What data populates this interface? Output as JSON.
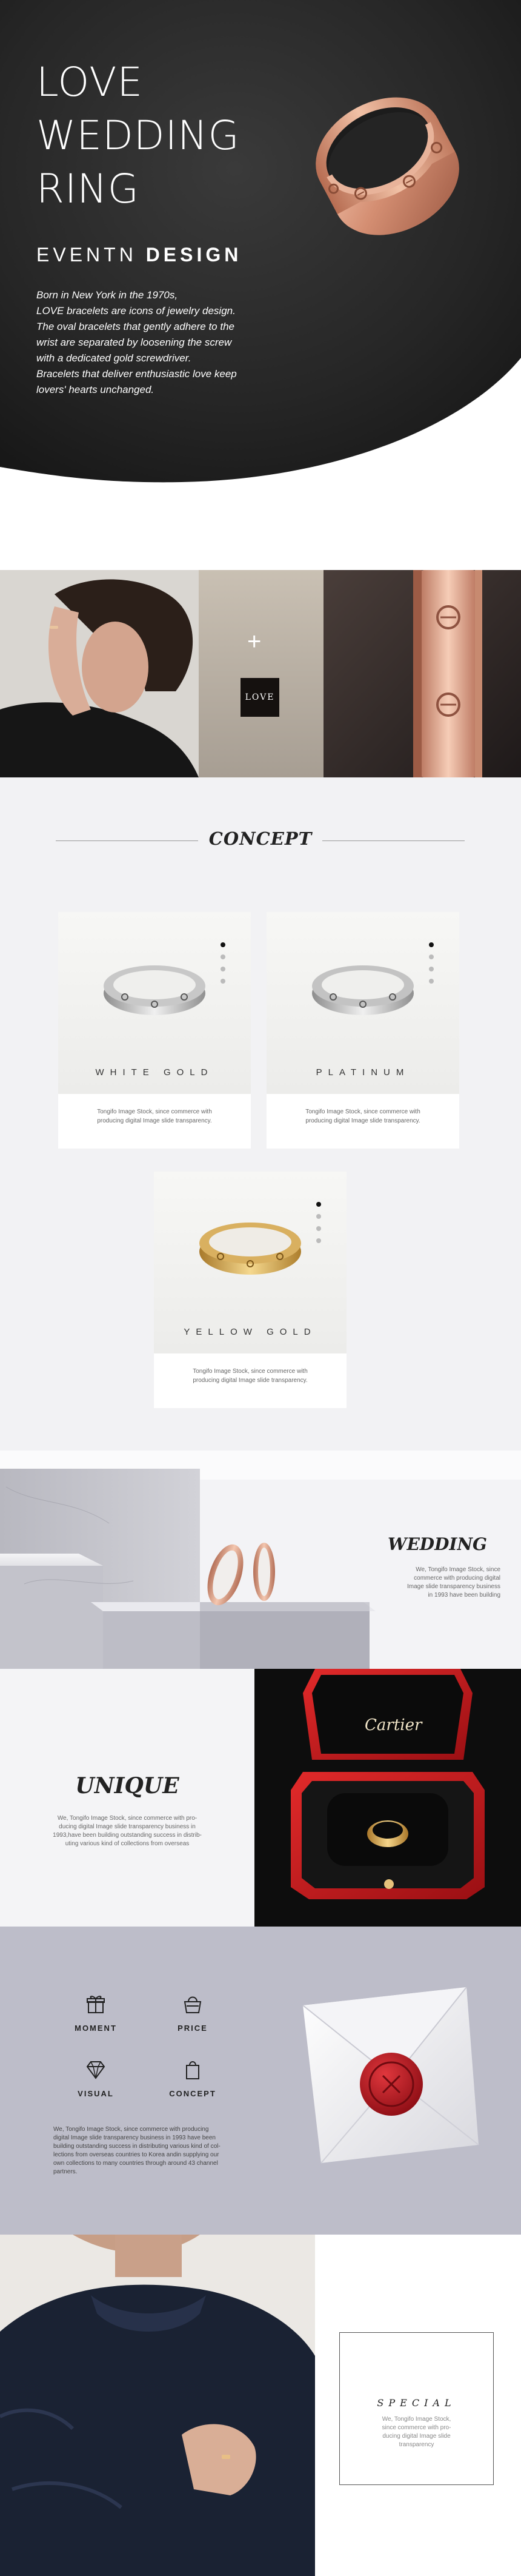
{
  "hero": {
    "title_lines": [
      "LOVE",
      "WEDDING",
      "RING"
    ],
    "subtitle_light": "EVENTN",
    "subtitle_bold": "DESIGN",
    "description_lines": [
      "Born in New York in the 1970s,",
      "LOVE bracelets are icons of jewelry design.",
      "The oval bracelets that gently adhere to the",
      "wrist are separated by loosening the screw",
      "with a dedicated gold screwdriver.",
      "Bracelets that deliver enthusiastic love keep",
      "lovers' hearts unchanged."
    ]
  },
  "strip": {
    "plus": "+",
    "badge": "LOVE"
  },
  "concept": {
    "title": "CONCEPT",
    "cards": [
      {
        "label": "WHITE GOLD",
        "text_lines": [
          "Tongifo Image Stock, since commerce with",
          "producing digital Image slide transparency."
        ]
      },
      {
        "label": "PLATINUM",
        "text_lines": [
          "Tongifo Image Stock, since commerce with",
          "producing digital Image slide transparency."
        ]
      },
      {
        "label": "YELLOW GOLD",
        "text_lines": [
          "Tongifo Image Stock, since commerce with",
          "producing digital Image slide transparency."
        ]
      }
    ]
  },
  "wedding": {
    "title": "WEDDING",
    "text_lines": [
      "We, Tongifo Image Stock, since",
      "commerce with producing digital",
      "Image slide transparency business",
      "in 1993 have been building"
    ]
  },
  "unique": {
    "title": "UNIQUE",
    "box_brand": "Cartier",
    "text_lines": [
      "We, Tongifo Image Stock, since commerce with pro-",
      "ducing digital Image slide transparency business in",
      "1993,have been building outstanding success in distrib-",
      "uting various kind of collections from overseas"
    ]
  },
  "features": {
    "items": [
      {
        "label": "MOMENT",
        "icon": "gift-icon"
      },
      {
        "label": "PRICE",
        "icon": "handbag-icon"
      },
      {
        "label": "VISUAL",
        "icon": "diamond-icon"
      },
      {
        "label": "CONCEPT",
        "icon": "shopping-bag-icon"
      }
    ],
    "text_lines": [
      "We, Tongifo Image Stock, since commerce with producing",
      "digital Image slide transparency business in 1993 have been",
      "building outstanding success in distributing various kind of col-",
      "lections from overseas countries to Korea andin supplying our",
      "own collections to many countries through around 43 channel",
      "partners."
    ]
  },
  "special": {
    "title": "SPECIAL",
    "text_lines": [
      "We, Tongifo Image Stock,",
      "since commerce with pro-",
      "ducing digital Image slide",
      "transparency"
    ]
  },
  "colors": {
    "hero_dark": "#1f1f1f",
    "rose_gold": "#d9987e",
    "concept_bg": "#f2f2f4",
    "features_bg": "#bdbdc9",
    "red_box": "#c4181c"
  }
}
